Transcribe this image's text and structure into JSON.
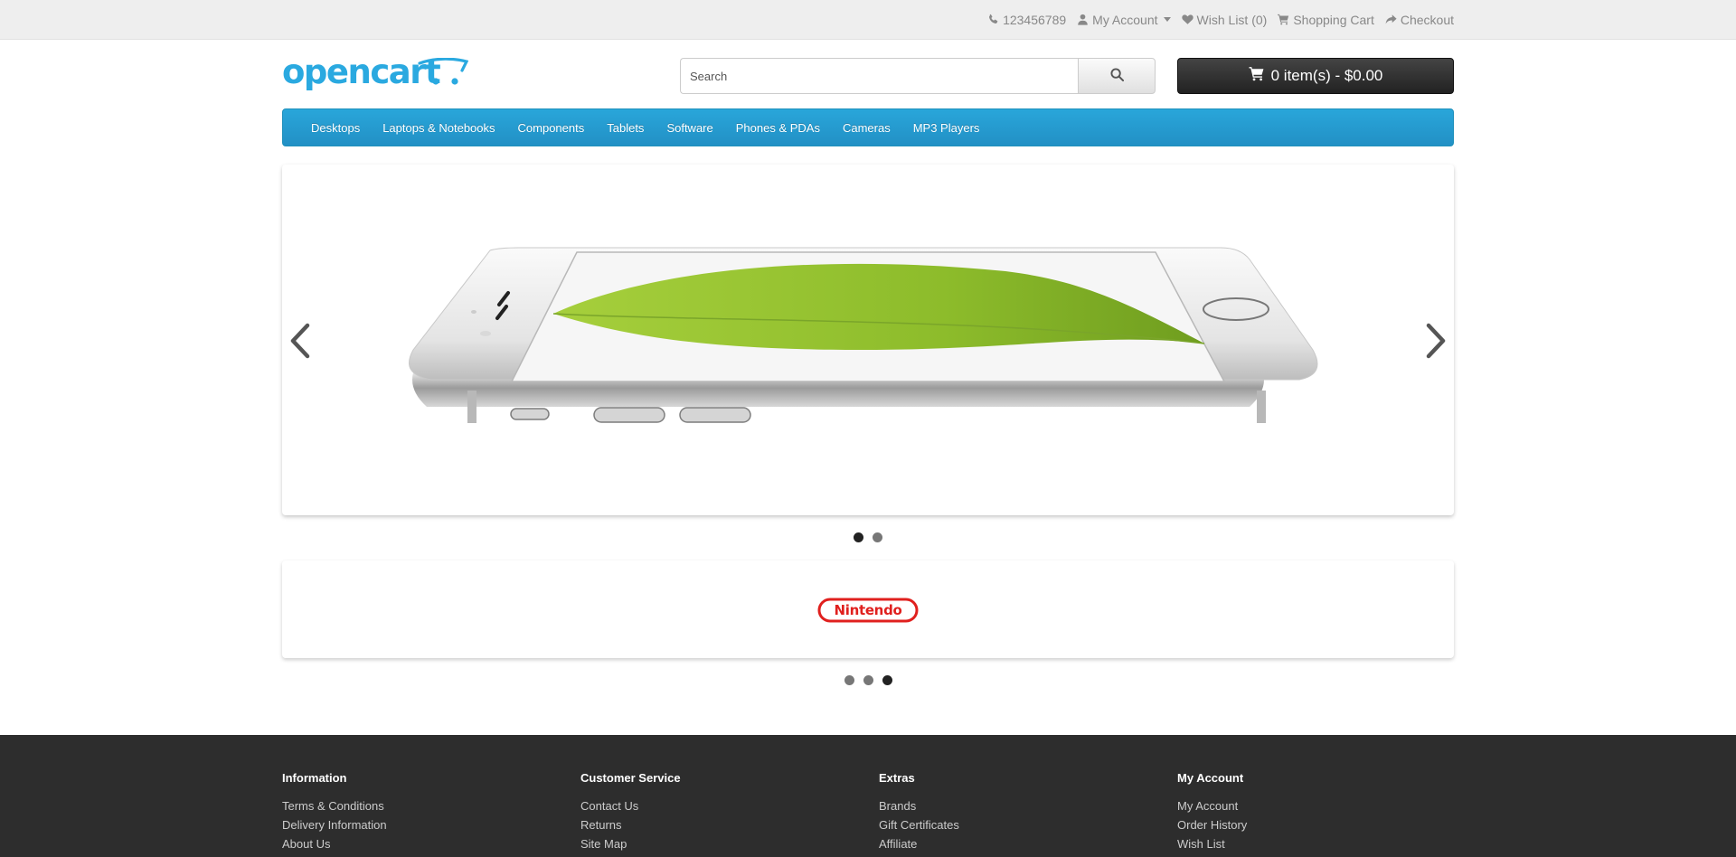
{
  "top_bar": {
    "phone": "123456789",
    "my_account": "My Account",
    "wish_list": "Wish List (0)",
    "shopping_cart": "Shopping Cart",
    "checkout": "Checkout"
  },
  "header": {
    "logo_text": "opencart",
    "search_placeholder": "Search",
    "search_value": "",
    "cart_label": "0 item(s) - $0.00"
  },
  "menu": {
    "items": [
      "Desktops",
      "Laptops & Notebooks",
      "Components",
      "Tablets",
      "Software",
      "Phones & PDAs",
      "Cameras",
      "MP3 Players"
    ]
  },
  "slideshow": {
    "slide_count": 2,
    "active_index": 0
  },
  "carousel": {
    "brand": "Nintendo",
    "dot_count": 3,
    "active_index": 2
  },
  "footer": {
    "columns": [
      {
        "title": "Information",
        "links": [
          "Terms & Conditions",
          "Delivery Information",
          "About Us"
        ]
      },
      {
        "title": "Customer Service",
        "links": [
          "Contact Us",
          "Returns",
          "Site Map"
        ]
      },
      {
        "title": "Extras",
        "links": [
          "Brands",
          "Gift Certificates",
          "Affiliate"
        ]
      },
      {
        "title": "My Account",
        "links": [
          "My Account",
          "Order History",
          "Wish List"
        ]
      }
    ]
  },
  "colors": {
    "menu_blue": "#229ac8",
    "logo_blue": "#2aa9e0",
    "footer_bg": "#2d2d2d",
    "cart_btn": "#333333"
  }
}
